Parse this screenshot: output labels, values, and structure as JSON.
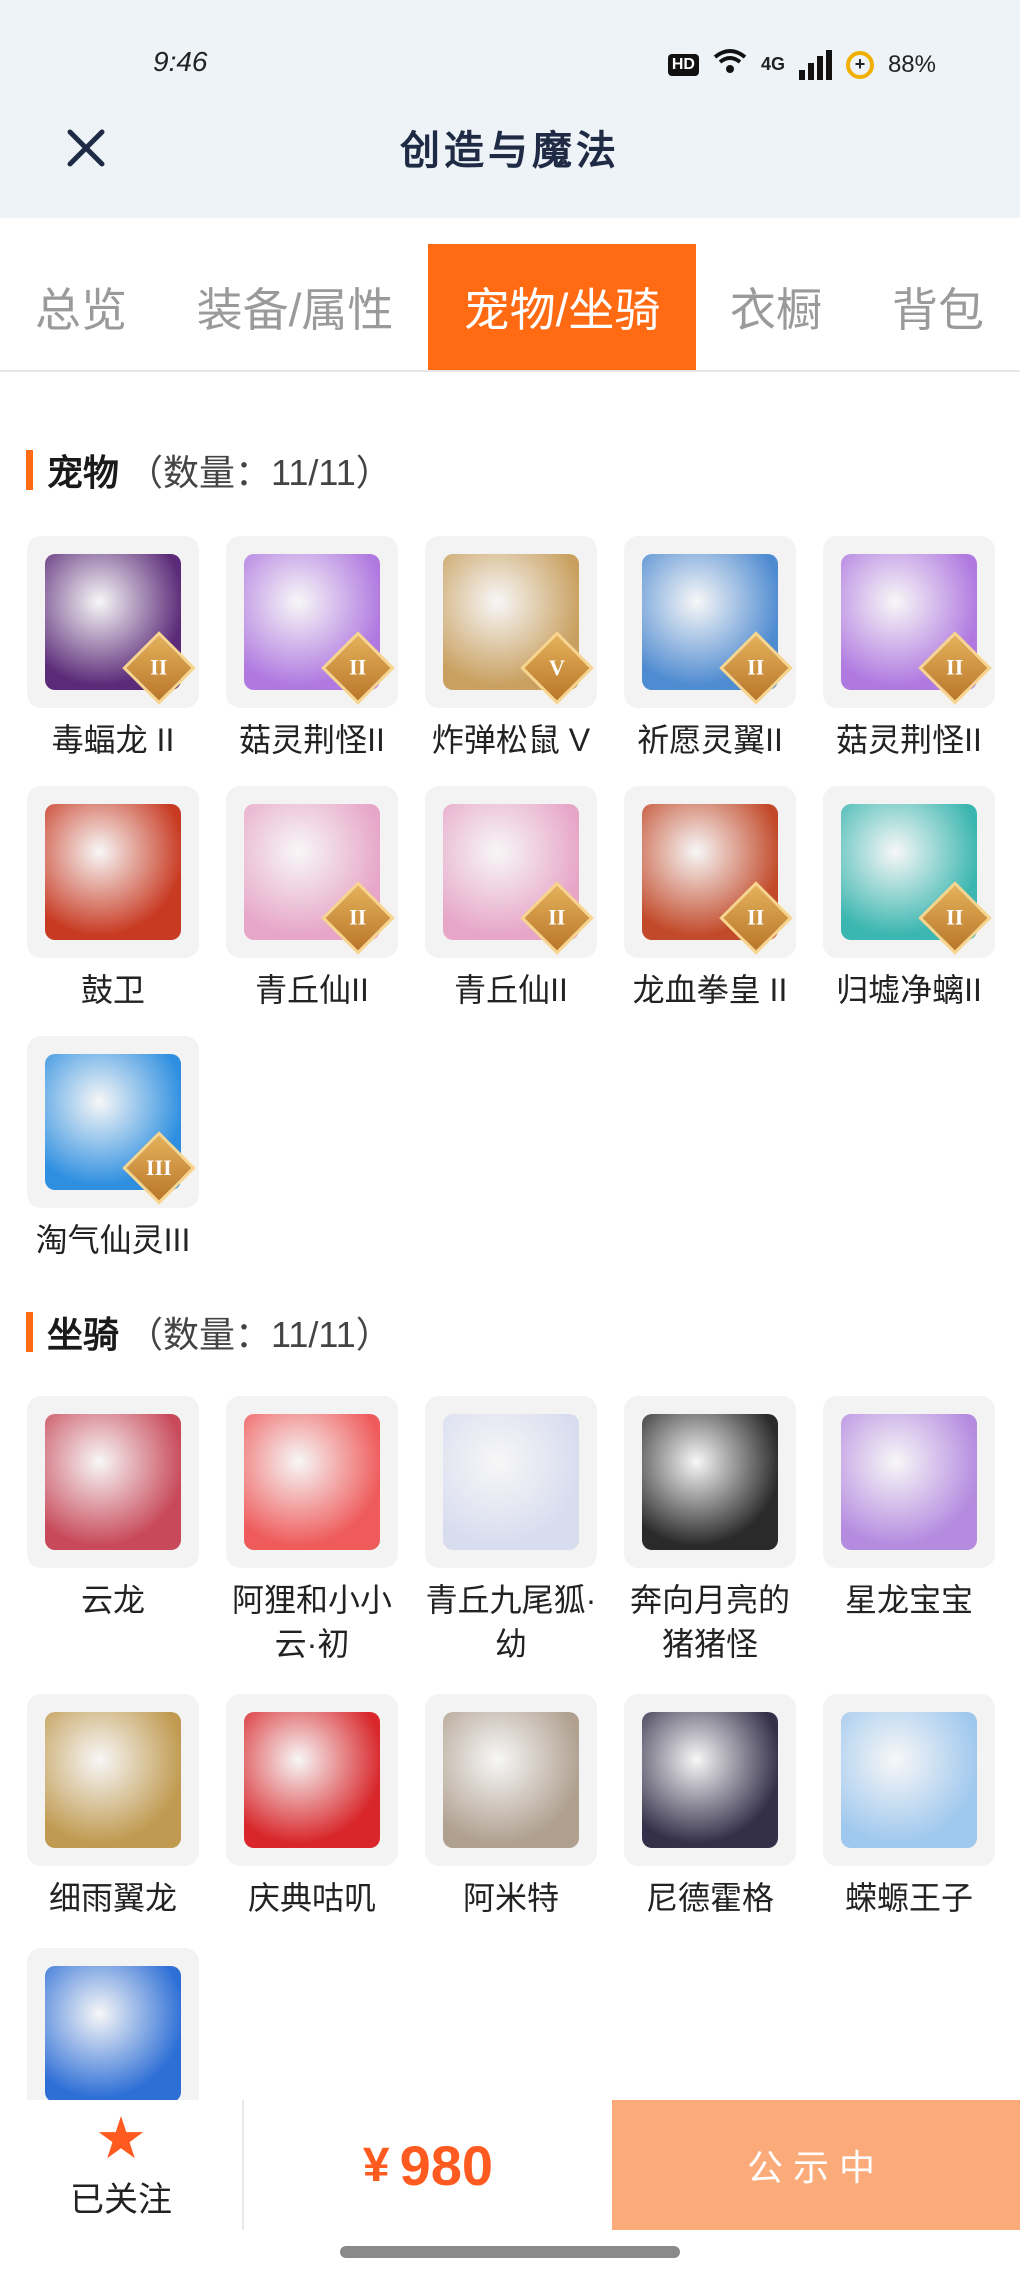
{
  "status": {
    "time": "9:46",
    "hd": "HD",
    "network": "4G",
    "battery": "88%"
  },
  "header": {
    "title": "创造与魔法"
  },
  "tabs": [
    {
      "label": "总览",
      "active": false
    },
    {
      "label": "装备/属性",
      "active": false
    },
    {
      "label": "宠物/坐骑",
      "active": true
    },
    {
      "label": "衣橱",
      "active": false
    },
    {
      "label": "背包",
      "active": false
    }
  ],
  "pets": {
    "title": "宠物",
    "count": "（数量：11/11）",
    "items": [
      {
        "name": "毒蝠龙 II",
        "rank": "II",
        "color": "#5b2a78",
        "icon": "dragon-icon"
      },
      {
        "name": "菇灵荆怪II",
        "rank": "II",
        "color": "#b079e0",
        "icon": "mushroom-icon"
      },
      {
        "name": "炸弹松鼠 V",
        "rank": "V",
        "color": "#c9a060",
        "icon": "squirrel-icon"
      },
      {
        "name": "祈愿灵翼II",
        "rank": "II",
        "color": "#4f8bd1",
        "icon": "bird-icon"
      },
      {
        "name": "菇灵荆怪II",
        "rank": "II",
        "color": "#b079e0",
        "icon": "mushroom-icon"
      },
      {
        "name": "鼓卫",
        "rank": "",
        "color": "#c83a22",
        "icon": "drum-icon"
      },
      {
        "name": "青丘仙II",
        "rank": "II",
        "color": "#e7a6c8",
        "icon": "fox-fairy-icon"
      },
      {
        "name": "青丘仙II",
        "rank": "II",
        "color": "#e7a6c8",
        "icon": "fox-fairy-icon"
      },
      {
        "name": "龙血拳皇 II",
        "rank": "II",
        "color": "#c24a2a",
        "icon": "beast-icon"
      },
      {
        "name": "归墟净螭II",
        "rank": "II",
        "color": "#3bb6b0",
        "icon": "serpent-icon"
      },
      {
        "name": "淘气仙灵III",
        "rank": "III",
        "color": "#2e8fe0",
        "icon": "dog-icon"
      }
    ]
  },
  "mounts": {
    "title": "坐骑",
    "count": "（数量：11/11）",
    "items": [
      {
        "name": "云龙",
        "color": "#c84a5a",
        "icon": "dragon-icon"
      },
      {
        "name": "阿狸和小小云·初",
        "color": "#ef5b5b",
        "icon": "fox-icon"
      },
      {
        "name": "青丘九尾狐·幼",
        "color": "#d8dcef",
        "icon": "fox-icon"
      },
      {
        "name": "奔向月亮的猪猪怪",
        "color": "#2a2a2a",
        "icon": "pig-icon"
      },
      {
        "name": "星龙宝宝",
        "color": "#b58be0",
        "icon": "dragon-icon"
      },
      {
        "name": "细雨翼龙",
        "color": "#c09a50",
        "icon": "bird-icon"
      },
      {
        "name": "庆典咕叽",
        "color": "#d8262a",
        "icon": "mascot-icon"
      },
      {
        "name": "阿米特",
        "color": "#b0a090",
        "icon": "crocodile-icon"
      },
      {
        "name": "尼德霍格",
        "color": "#34304a",
        "icon": "dragon-icon"
      },
      {
        "name": "蝾螈王子",
        "color": "#9fc8ee",
        "icon": "axolotl-icon"
      },
      {
        "name": "",
        "color": "#2e6fd6",
        "icon": "dragon-icon"
      }
    ]
  },
  "bottom": {
    "follow_label": "已关注",
    "currency": "¥",
    "price": "980",
    "cta_label": "公示中"
  },
  "colors": {
    "accent": "#ff6a13",
    "price": "#ff5a1f",
    "cta_bg": "#fbab7a"
  }
}
